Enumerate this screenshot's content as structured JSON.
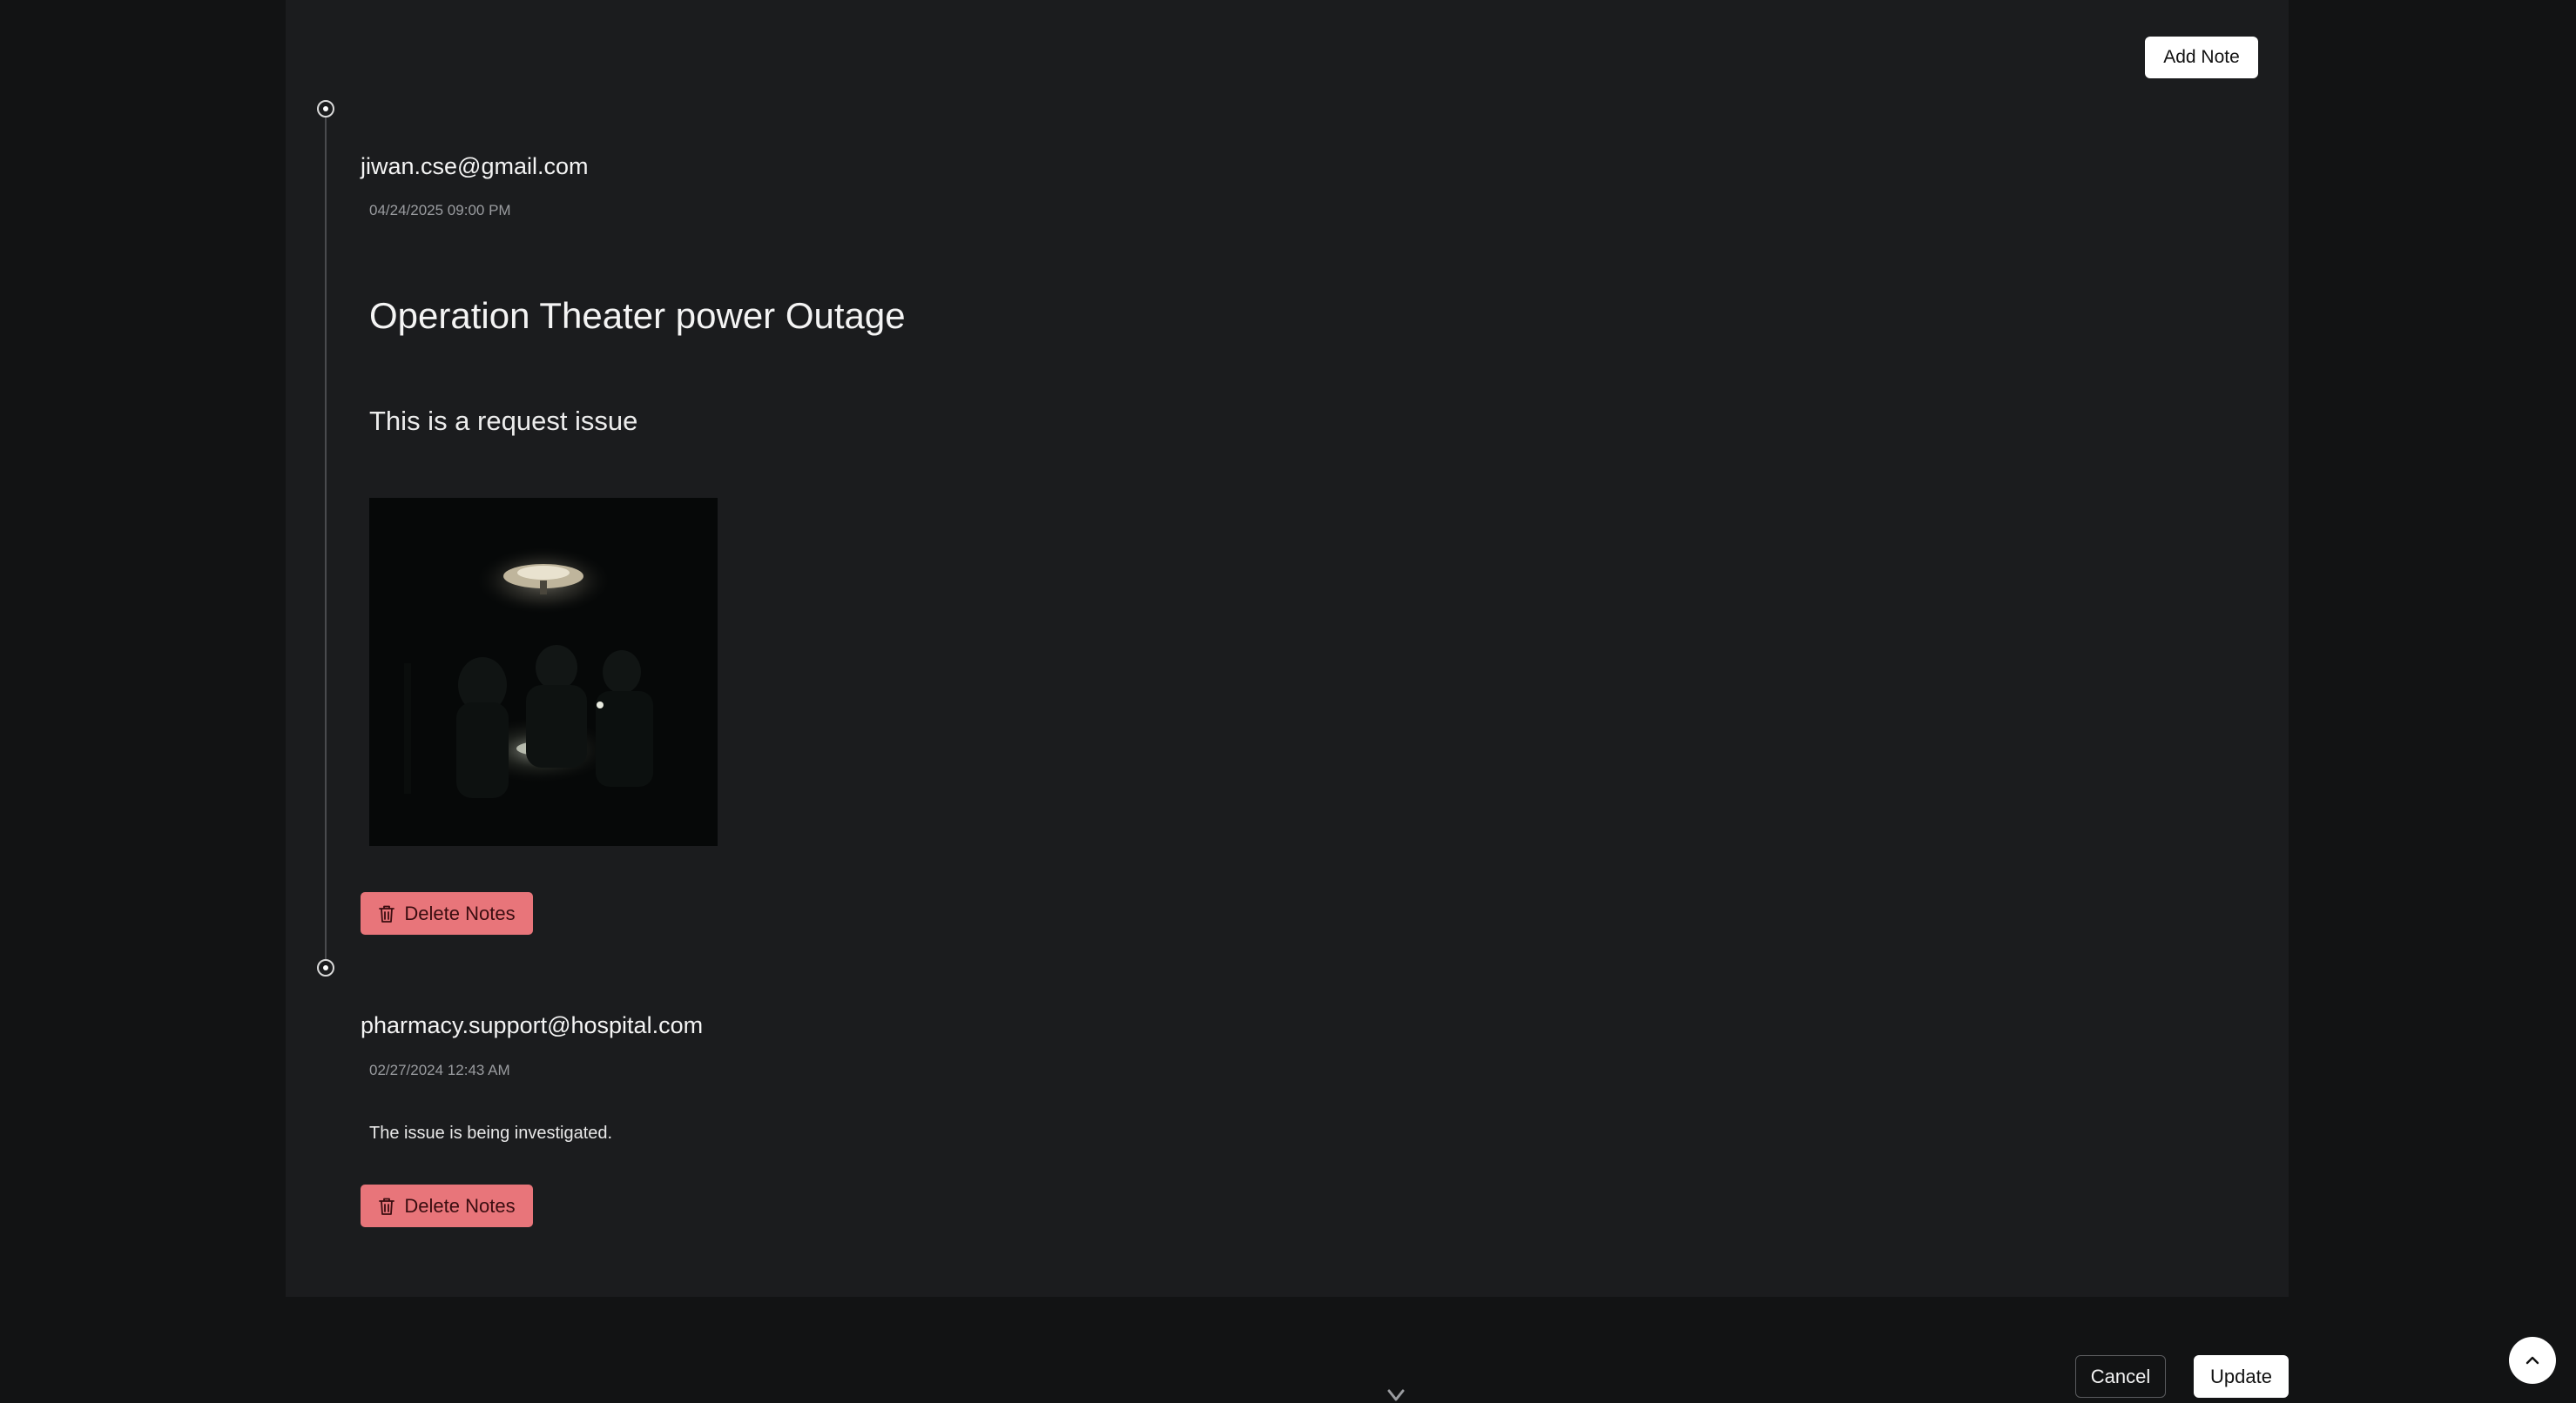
{
  "toolbar": {
    "add_note_label": "Add Note"
  },
  "notes": [
    {
      "author": "jiwan.cse@gmail.com",
      "date": "04/24/2025 09:00 PM",
      "title": "Operation Theater power Outage",
      "body": "This is a request issue",
      "has_image": true,
      "delete_label": "Delete Notes"
    },
    {
      "author": "pharmacy.support@hospital.com",
      "date": "02/27/2024 12:43 AM",
      "body": "The issue is being investigated.",
      "delete_label": "Delete Notes"
    }
  ],
  "footer": {
    "cancel_label": "Cancel",
    "update_label": "Update"
  },
  "icons": {
    "delete": "trash-icon",
    "scroll_top": "chevron-up-icon",
    "bottom_indicator": "chevron-down-icon",
    "timeline": "timeline-dot-icon"
  },
  "colors": {
    "background": "#121314",
    "panel": "#1b1c1e",
    "delete_button": "#e8757a",
    "primary_button": "#ffffff"
  }
}
